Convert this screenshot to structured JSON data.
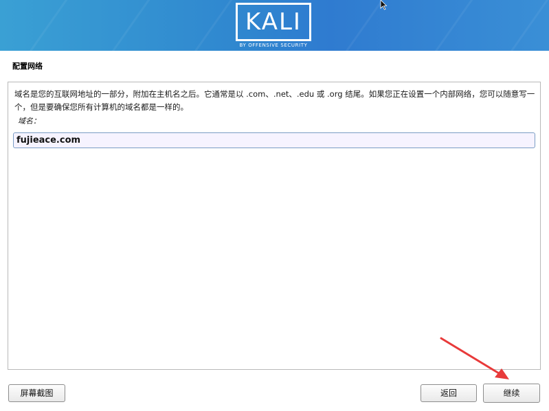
{
  "banner": {
    "logo_text": "KALI",
    "logo_subtitle": "BY OFFENSIVE SECURITY"
  },
  "page": {
    "title": "配置网络"
  },
  "main": {
    "description": "域名是您的互联网地址的一部分，附加在主机名之后。它通常是以 .com、.net、.edu 或 .org 结尾。如果您正在设置一个内部网络，您可以随意写一个，但是要确保您所有计算机的域名都是一样的。",
    "field_label": "域名：",
    "domain_value": "fujieace.com"
  },
  "buttons": {
    "screenshot": "屏幕截图",
    "back": "返回",
    "continue": "继续"
  },
  "colors": {
    "banner_left": "#3aa0d4",
    "banner_right": "#2f7bd0",
    "annotation_arrow": "#e83a3a"
  }
}
